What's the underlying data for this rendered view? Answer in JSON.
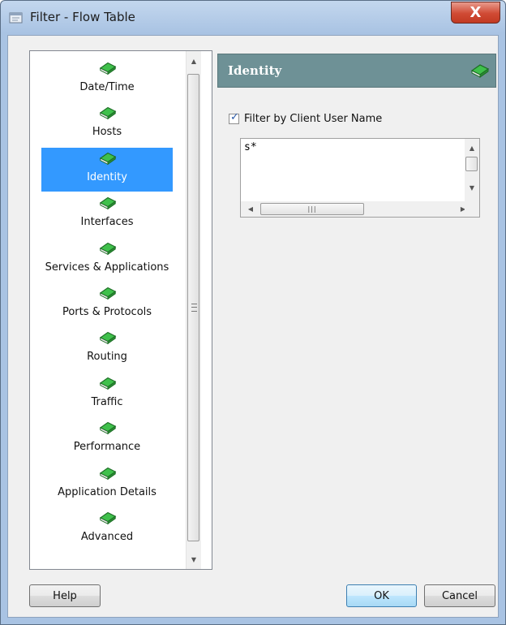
{
  "window": {
    "title": "Filter - Flow Table",
    "close_label": "X"
  },
  "nav": {
    "items": [
      {
        "label": "Date/Time",
        "icon": "green-book-icon"
      },
      {
        "label": "Hosts",
        "icon": "green-book-icon"
      },
      {
        "label": "Identity",
        "icon": "green-book-icon",
        "selected": true
      },
      {
        "label": "Interfaces",
        "icon": "green-book-icon"
      },
      {
        "label": "Services & Applications",
        "icon": "green-book-icon"
      },
      {
        "label": "Ports & Protocols",
        "icon": "green-book-icon"
      },
      {
        "label": "Routing",
        "icon": "green-book-icon"
      },
      {
        "label": "Traffic",
        "icon": "green-book-icon"
      },
      {
        "label": "Performance",
        "icon": "green-book-icon"
      },
      {
        "label": "Application Details",
        "icon": "green-book-icon"
      },
      {
        "label": "Advanced",
        "icon": "green-book-icon"
      }
    ]
  },
  "panel": {
    "title": "Identity",
    "filter_checkbox": {
      "label": "Filter by Client User Name",
      "checked": true
    },
    "textarea_value": "s*"
  },
  "buttons": {
    "help": "Help",
    "ok": "OK",
    "cancel": "Cancel"
  },
  "colors": {
    "selection": "#3399ff",
    "panel_header": "#6e9196",
    "book_green": "#2fa03a"
  }
}
